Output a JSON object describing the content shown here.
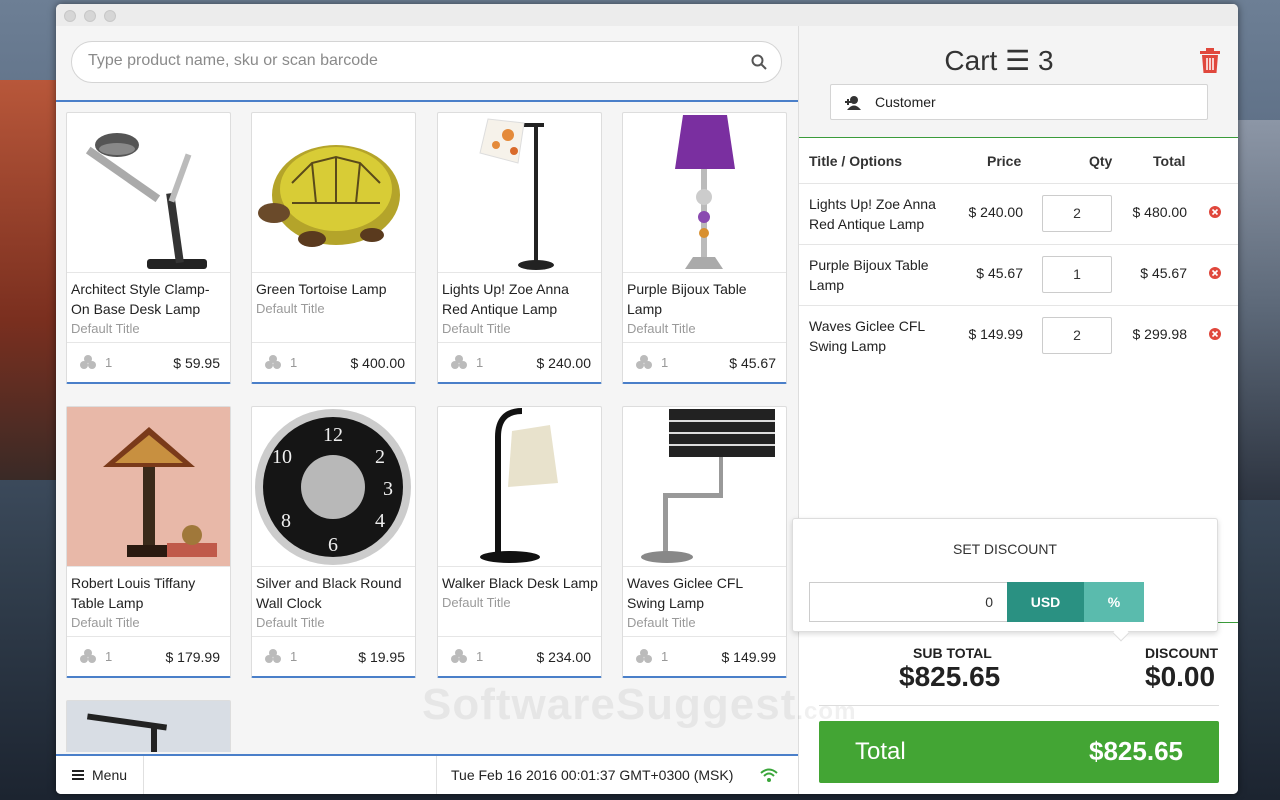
{
  "search": {
    "placeholder": "Type product name, sku or scan barcode"
  },
  "products": [
    {
      "name": "Architect Style Clamp-On Base Desk Lamp",
      "sub": "Default Title",
      "qty": "1",
      "price": "$ 59.95"
    },
    {
      "name": "Green Tortoise Lamp",
      "sub": "Default Title",
      "qty": "1",
      "price": "$ 400.00"
    },
    {
      "name": "Lights Up! Zoe Anna Red Antique Lamp",
      "sub": "Default Title",
      "qty": "1",
      "price": "$ 240.00"
    },
    {
      "name": "Purple Bijoux Table Lamp",
      "sub": "Default Title",
      "qty": "1",
      "price": "$ 45.67"
    },
    {
      "name": "Robert Louis Tiffany Table Lamp",
      "sub": "Default Title",
      "qty": "1",
      "price": "$ 179.99"
    },
    {
      "name": "Silver and Black Round Wall Clock",
      "sub": "Default Title",
      "qty": "1",
      "price": "$ 19.95"
    },
    {
      "name": "Walker Black Desk Lamp",
      "sub": "Default Title",
      "qty": "1",
      "price": "$ 234.00"
    },
    {
      "name": "Waves Giclee CFL Swing Lamp",
      "sub": "Default Title",
      "qty": "1",
      "price": "$ 149.99"
    }
  ],
  "footer": {
    "menu_label": "Menu",
    "datetime": "Tue Feb 16 2016 00:01:37 GMT+0300 (MSK)"
  },
  "cart": {
    "title": "Cart ☰ 3",
    "customer_label": "Customer",
    "columns": {
      "title": "Title / Options",
      "price": "Price",
      "qty": "Qty",
      "total": "Total"
    },
    "items": [
      {
        "title": "Lights Up! Zoe Anna Red Antique Lamp",
        "price": "$ 240.00",
        "qty": "2",
        "total": "$ 480.00"
      },
      {
        "title": "Purple Bijoux Table Lamp",
        "price": "$ 45.67",
        "qty": "1",
        "total": "$ 45.67"
      },
      {
        "title": "Waves Giclee CFL Swing Lamp",
        "price": "$ 149.99",
        "qty": "2",
        "total": "$ 299.98"
      }
    ],
    "subtotal_label": "SUB TOTAL",
    "subtotal": "$825.65",
    "discount_label": "DISCOUNT",
    "discount": "$0.00",
    "total_label": "Total",
    "total": "$825.65"
  },
  "discount_popup": {
    "title": "SET DISCOUNT",
    "value": "0",
    "usd_label": "USD",
    "percent_label": "%"
  },
  "watermark": {
    "main": "SoftwareSuggest",
    "suffix": ".com"
  },
  "colors": {
    "accent_blue": "#4a7fc9",
    "green": "#43a534",
    "teal": "#2a9182",
    "teal_light": "#5abbad",
    "trash_red": "#e0473c"
  }
}
